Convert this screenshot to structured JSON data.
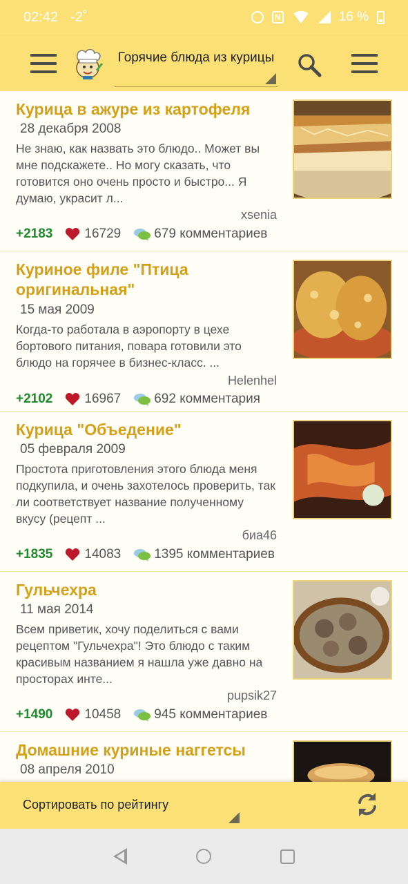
{
  "status_bar": {
    "time": "02:42",
    "temperature": "-2˚",
    "battery": "16 %"
  },
  "toolbar": {
    "title": "Горячие блюда из курицы",
    "menu_icon": "hamburger-icon",
    "search_icon": "search-icon",
    "more_icon": "menu-icon"
  },
  "recipes": [
    {
      "title": "Курица в ажуре из картофеля",
      "date": "28 декабря 2008",
      "description": "Не знаю, как назвать это блюдо.. Может вы мне подскажете.. Но могу сказать, что готовится оно очень просто и быстро... Я думаю, украсит л...",
      "author": "xsenia",
      "score": "+2183",
      "likes": "16729",
      "comments": "679 комментариев"
    },
    {
      "title": "Куриное филе \"Птица оригинальная\"",
      "date": "15 мая 2009",
      "description": "Когда-то работала в аэропорту в цехе бортового питания, повара готовили это блюдо на горячее в бизнес-класс. ...",
      "author": "Helenhel",
      "score": "+2102",
      "likes": "16967",
      "comments": "692 комментария"
    },
    {
      "title": "Курица \"Объедение\"",
      "date": "05 февраля 2009",
      "description": "Простота приготовления этого блюда меня подкупила, и очень захотелось проверить, так ли соответствует название полученному вкусу (рецепт ...",
      "author": "биа46",
      "score": "+1835",
      "likes": "14083",
      "comments": "1395 комментариев"
    },
    {
      "title": "Гульчехра",
      "date": "11 мая 2014",
      "description": "Всем приветик, хочу поделиться с вами рецептом \"Гульчехра\"! Это блюдо с таким красивым названием я нашла уже давно на просторах инте...",
      "author": "pupsik27",
      "score": "+1490",
      "likes": "10458",
      "comments": "945 комментариев"
    },
    {
      "title": "Домашние куриные наггетсы",
      "date": "08 апреля 2010"
    }
  ],
  "sort_bar": {
    "label": "Сортировать по рейтингу",
    "refresh_icon": "refresh-icon"
  },
  "colors": {
    "accent": "#fbe175",
    "title": "#d4a017",
    "score": "#1f8a2e",
    "heart": "#c0182b"
  }
}
